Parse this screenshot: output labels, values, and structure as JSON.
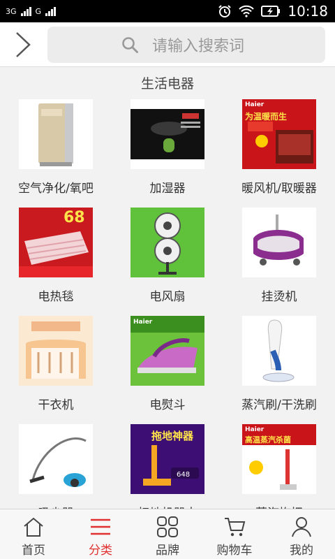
{
  "status_bar": {
    "network_1": "3G",
    "network_2": "G",
    "time": "10:18"
  },
  "search": {
    "placeholder": "请输入搜索词"
  },
  "section": {
    "title": "生活电器"
  },
  "products": [
    {
      "label": "空气净化/氧吧",
      "icon": "air-purifier"
    },
    {
      "label": "加湿器",
      "icon": "humidifier"
    },
    {
      "label": "暖风机/取暖器",
      "icon": "heater",
      "img_text": "为温暖而生",
      "brand": "Haier"
    },
    {
      "label": "电热毯",
      "icon": "electric-blanket",
      "img_text": "68"
    },
    {
      "label": "电风扇",
      "icon": "electric-fan"
    },
    {
      "label": "挂烫机",
      "icon": "garment-steamer"
    },
    {
      "label": "干衣机",
      "icon": "clothes-dryer"
    },
    {
      "label": "电熨斗",
      "icon": "iron",
      "brand": "Haier"
    },
    {
      "label": "蒸汽刷/干洗刷",
      "icon": "steam-brush"
    },
    {
      "label": "吸尘器",
      "icon": "vacuum-cleaner"
    },
    {
      "label": "扫地机器人",
      "icon": "robot-mop",
      "img_text": "拖地神器",
      "price": "648"
    },
    {
      "label": "蒸汽拖把",
      "icon": "steam-mop",
      "img_text": "高温蒸汽杀菌",
      "brand": "Haier"
    }
  ],
  "tabbar": [
    {
      "label": "首页",
      "icon": "home-icon",
      "active": false
    },
    {
      "label": "分类",
      "icon": "category-icon",
      "active": true
    },
    {
      "label": "品牌",
      "icon": "brand-icon",
      "active": false
    },
    {
      "label": "购物车",
      "icon": "cart-icon",
      "active": false
    },
    {
      "label": "我的",
      "icon": "user-icon",
      "active": false
    }
  ],
  "colors": {
    "accent": "#e03030",
    "background": "#f2f2f2"
  }
}
